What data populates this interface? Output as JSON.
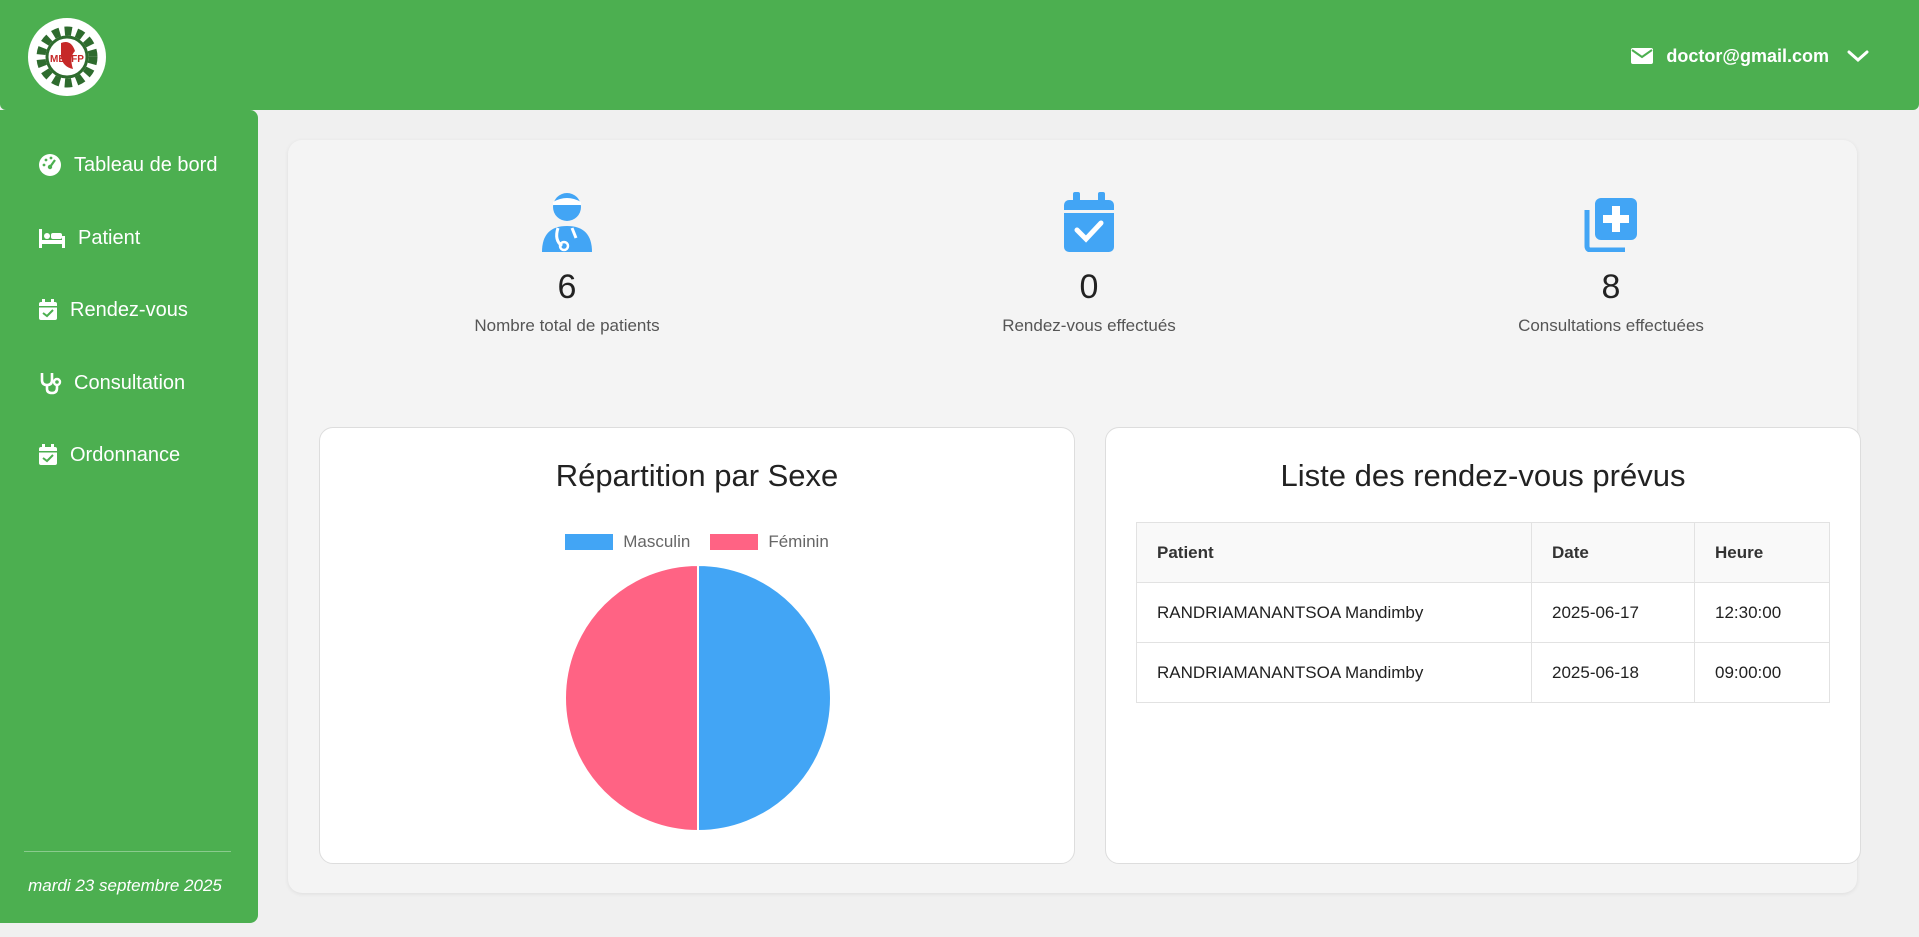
{
  "header": {
    "logo_text": "METFP",
    "user_email": "doctor@gmail.com",
    "colors": {
      "primary": "#4caf50"
    }
  },
  "sidebar": {
    "items": [
      {
        "label": "Tableau de bord",
        "icon": "gauge-icon"
      },
      {
        "label": "Patient",
        "icon": "bed-icon"
      },
      {
        "label": "Rendez-vous",
        "icon": "calendar-check-icon"
      },
      {
        "label": "Consultation",
        "icon": "stethoscope-icon"
      },
      {
        "label": "Ordonnance",
        "icon": "calendar-check-icon"
      }
    ],
    "date": "mardi 23 septembre 2025"
  },
  "stats": [
    {
      "value": "6",
      "label": "Nombre total de patients",
      "icon": "user-doctor-icon"
    },
    {
      "value": "0",
      "label": "Rendez-vous effectués",
      "icon": "calendar-check-icon"
    },
    {
      "value": "8",
      "label": "Consultations effectuées",
      "icon": "notes-medical-plus-icon"
    }
  ],
  "sex_card": {
    "title": "Répartition par Sexe"
  },
  "chart_data": {
    "type": "pie",
    "title": "Répartition par Sexe",
    "categories": [
      "Masculin",
      "Féminin"
    ],
    "values": [
      50,
      50
    ],
    "colors": [
      "#42a5f5",
      "#ff6384"
    ],
    "legend": "top"
  },
  "appointments": {
    "title": "Liste des rendez-vous prévus",
    "columns": [
      "Patient",
      "Date",
      "Heure"
    ],
    "rows": [
      [
        "RANDRIAMANANTSOA Mandimby",
        "2025-06-17",
        "12:30:00"
      ],
      [
        "RANDRIAMANANTSOA Mandimby",
        "2025-06-18",
        "09:00:00"
      ]
    ]
  }
}
